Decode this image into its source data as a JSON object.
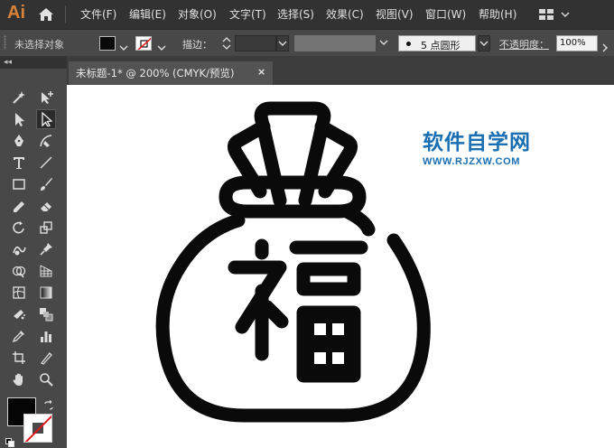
{
  "app": {
    "logo": "Ai"
  },
  "menu": {
    "items": [
      "文件(F)",
      "编辑(E)",
      "对象(O)",
      "文字(T)",
      "选择(S)",
      "效果(C)",
      "视图(V)",
      "窗口(W)",
      "帮助(H)"
    ]
  },
  "control_bar": {
    "selection_status": "未选择对象",
    "stroke_label": "描边：",
    "brush": {
      "size": "5",
      "name": "点圆形"
    },
    "opacity_label": "不透明度：",
    "opacity_value": "100%"
  },
  "colors": {
    "fill": "#000000",
    "stroke": "none",
    "accent_logo": "#d9833a",
    "watermark": "#1a6fb3"
  },
  "tools": [
    "magic-wand-tool",
    "anchor-add-tool",
    "selection-tool",
    "direct-selection-tool",
    "pen-tool",
    "curvature-tool",
    "type-tool",
    "line-segment-tool",
    "rectangle-tool",
    "paintbrush-tool",
    "shaper-tool",
    "eraser-tool",
    "rotate-tool",
    "scale-tool",
    "warp-tool",
    "puppet-warp-tool",
    "shape-builder-tool",
    "perspective-grid-tool",
    "mesh-tool",
    "gradient-tool",
    "symbol-sprayer-tool",
    "blend-tool",
    "eyedropper-tool",
    "column-graph-tool",
    "artboard-tool",
    "slice-tool",
    "hand-tool",
    "zoom-tool"
  ],
  "active_tool": "direct-selection-tool",
  "document": {
    "tab_label": "未标题-1* @ 200% (CMYK/预览)",
    "close_glyph": "×"
  },
  "watermark": {
    "title": "软件自学网",
    "url": "WWW.RJZXW.COM"
  },
  "artwork": {
    "character": "福",
    "subject": "money-bag-icon"
  }
}
